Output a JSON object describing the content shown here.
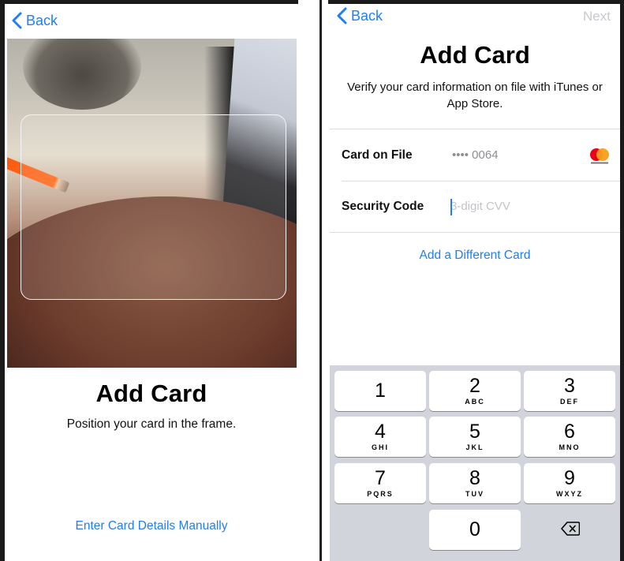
{
  "left": {
    "back_label": "Back",
    "title": "Add Card",
    "subtitle": "Position your card in the frame.",
    "manual_link": "Enter Card Details Manually"
  },
  "right": {
    "back_label": "Back",
    "next_label": "Next",
    "title": "Add Card",
    "subtitle": "Verify your card information on file with iTunes or App Store.",
    "rows": {
      "card_on_file": {
        "label": "Card on File",
        "value": "•••• 0064",
        "icon": "mastercard-icon"
      },
      "security_code": {
        "label": "Security Code",
        "placeholder": "3-digit CVV",
        "value": ""
      }
    },
    "different_card_link": "Add a Different Card"
  },
  "keypad": {
    "keys": [
      {
        "digit": "1",
        "letters": ""
      },
      {
        "digit": "2",
        "letters": "ABC"
      },
      {
        "digit": "3",
        "letters": "DEF"
      },
      {
        "digit": "4",
        "letters": "GHI"
      },
      {
        "digit": "5",
        "letters": "JKL"
      },
      {
        "digit": "6",
        "letters": "MNO"
      },
      {
        "digit": "7",
        "letters": "PQRS"
      },
      {
        "digit": "8",
        "letters": "TUV"
      },
      {
        "digit": "9",
        "letters": "WXYZ"
      },
      {
        "digit": "0",
        "letters": ""
      }
    ],
    "delete_icon": "backspace-icon"
  },
  "colors": {
    "accent": "#1f7ef2",
    "disabled": "#c9c9ce",
    "keypad_bg": "#d1d4da",
    "mastercard_red": "#eb001b",
    "mastercard_orange": "#f79e1b"
  }
}
